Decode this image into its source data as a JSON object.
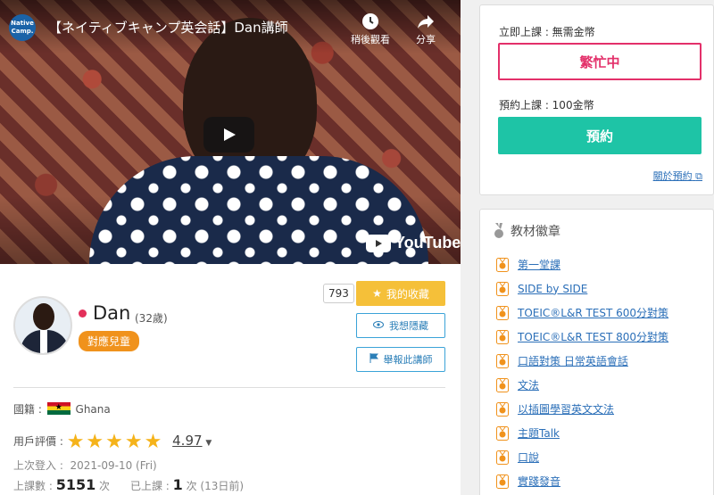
{
  "video": {
    "channel_logo": "Native Camp.",
    "title": "【ネイティブキャンプ英会話】Dan講師",
    "watch_later": "稍後觀看",
    "share": "分享",
    "brand": "YouTube"
  },
  "teacher": {
    "name": "Dan",
    "age": "(32歲)",
    "kids_badge": "對應兒童",
    "favorite_count": "793",
    "favorite_label": "我的收藏",
    "hide_label": "我想隱藏",
    "report_label": "舉報此講師",
    "country_label": "國籍 :",
    "country": "Ghana",
    "rating_label": "用戶評價 :",
    "rating": "4.97",
    "stars": 5,
    "last_login_label": "上次登入 :",
    "last_login": "2021-09-10 (Fri)",
    "lessons_label": "上課數 :",
    "lessons_count": "5151",
    "lessons_unit": "次",
    "taken_label": "已上課 :",
    "taken_count": "1",
    "taken_unit": "次 (13日前)"
  },
  "booking": {
    "instant_label": "立即上課 : 無需金幣",
    "busy_label": "繁忙中",
    "reserve_cost": "預約上課 : 100金幣",
    "reserve_button": "預約",
    "about_link": "關於預約"
  },
  "badges": {
    "title": "教材徽章",
    "items": [
      "第一堂課",
      "SIDE by SIDE",
      "TOEIC®L&R TEST 600分對策",
      "TOEIC®L&R TEST 800分對策",
      "口語對策 日常英語會話",
      "文法",
      "以插圖學習英文文法",
      "主題Talk",
      "口說",
      "實踐發音"
    ]
  },
  "colors": {
    "accent_pink": "#e3306a",
    "accent_green": "#1ec4a6",
    "favorite_yellow": "#f5c039",
    "badge_orange": "#f0921c"
  }
}
